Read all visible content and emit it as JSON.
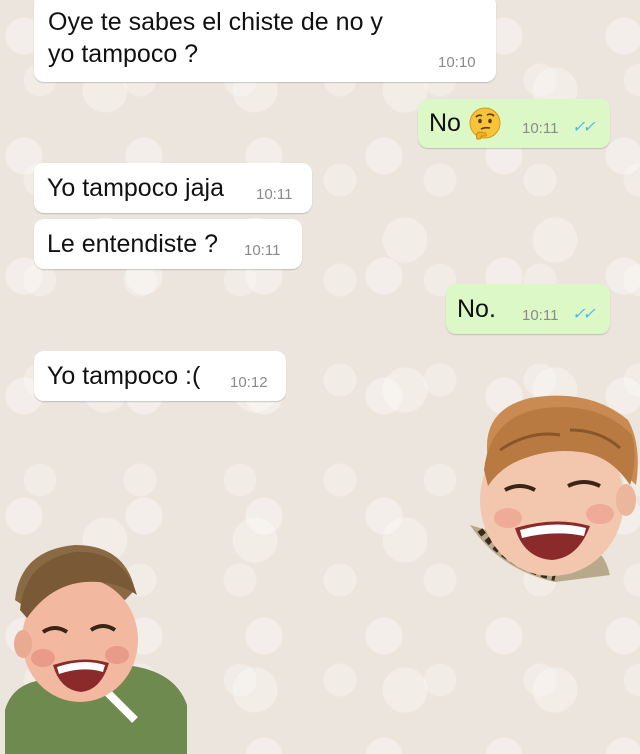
{
  "messages": [
    {
      "text_line1": "Oye te sabes el chiste de no y",
      "text_line2": "yo tampoco ?",
      "time": "10:10",
      "direction": "incoming"
    },
    {
      "text": "No",
      "emoji": "thinking-face",
      "time": "10:11",
      "status": "read",
      "ticks": "✓✓",
      "direction": "outgoing"
    },
    {
      "text": "Yo tampoco jaja",
      "time": "10:11",
      "direction": "incoming"
    },
    {
      "text": "Le entendiste ?",
      "time": "10:11",
      "direction": "incoming"
    },
    {
      "text": "No.",
      "time": "10:11",
      "status": "read",
      "ticks": "✓✓",
      "direction": "outgoing"
    },
    {
      "text": "Yo tampoco :(",
      "time": "10:12",
      "direction": "incoming"
    }
  ],
  "colors": {
    "wallpaper": "#ece5dd",
    "incoming_bubble": "#ffffff",
    "outgoing_bubble": "#dcf8c6",
    "read_ticks": "#4fb6ec"
  },
  "stickers": [
    {
      "name": "laughing-boy-sticker-right"
    },
    {
      "name": "laughing-boy-sticker-left"
    }
  ]
}
